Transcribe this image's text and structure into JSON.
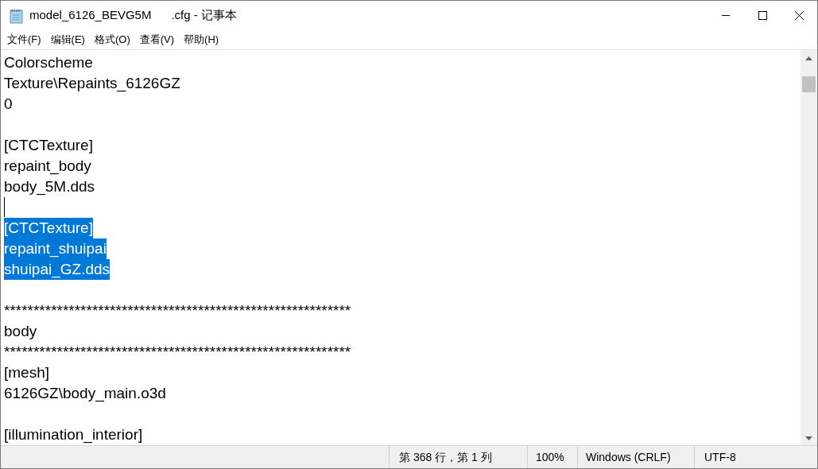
{
  "window": {
    "title": "model_6126_BEVG5M      .cfg - 记事本"
  },
  "menu": [
    "文件(F)",
    "编辑(E)",
    "格式(O)",
    "查看(V)",
    "帮助(H)"
  ],
  "lines": [
    {
      "kind": "text",
      "text": "Colorscheme",
      "selected": false
    },
    {
      "kind": "text",
      "text": "Texture\\Repaints_6126GZ",
      "selected": false
    },
    {
      "kind": "text",
      "text": "0",
      "selected": false
    },
    {
      "kind": "blank"
    },
    {
      "kind": "text",
      "text": "[CTCTexture]",
      "selected": false
    },
    {
      "kind": "text",
      "text": "repaint_body",
      "selected": false
    },
    {
      "kind": "text",
      "text": "body_5M.dds",
      "selected": false
    },
    {
      "kind": "caret"
    },
    {
      "kind": "text",
      "text": "[CTCTexture]",
      "selected": true
    },
    {
      "kind": "text",
      "text": "repaint_shuipai",
      "selected": true
    },
    {
      "kind": "text",
      "text": "shuipai_GZ.dds",
      "selected": true
    },
    {
      "kind": "blank"
    },
    {
      "kind": "text",
      "text": "***********************************************************",
      "selected": false
    },
    {
      "kind": "text",
      "text": "body",
      "selected": false
    },
    {
      "kind": "text",
      "text": "***********************************************************",
      "selected": false
    },
    {
      "kind": "text",
      "text": "[mesh]",
      "selected": false
    },
    {
      "kind": "text",
      "text": "6126GZ\\body_main.o3d",
      "selected": false
    },
    {
      "kind": "blank"
    },
    {
      "kind": "text",
      "text": "[illumination_interior]",
      "selected": false
    }
  ],
  "status_bar": [
    "第 368 行，第 1 列",
    "100%",
    "Windows (CRLF)",
    "UTF-8"
  ]
}
